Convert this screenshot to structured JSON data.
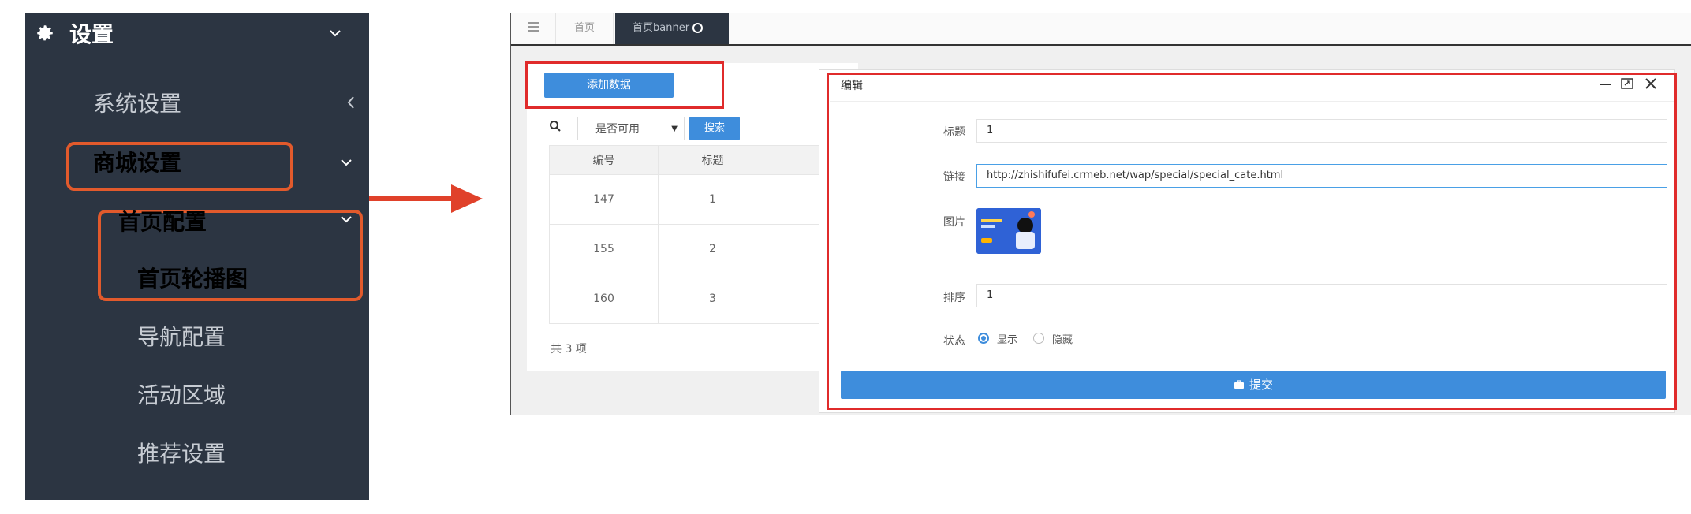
{
  "sidebar": {
    "header": {
      "icon": "gear-icon",
      "title": "设置"
    },
    "items": [
      {
        "label": "系统设置"
      },
      {
        "label": "商城设置"
      },
      {
        "label": "首页配置"
      },
      {
        "label": "首页轮播图"
      },
      {
        "label": "导航配置"
      },
      {
        "label": "活动区域"
      },
      {
        "label": "推荐设置"
      }
    ]
  },
  "tabs": {
    "menu_icon": "hamburger-icon",
    "home": "首页",
    "active": "首页banner"
  },
  "list": {
    "add_button": "添加数据",
    "filter_placeholder": "是否可用",
    "search_button": "搜索",
    "columns": [
      "编号",
      "标题"
    ],
    "rows": [
      {
        "id": "147",
        "title": "1"
      },
      {
        "id": "155",
        "title": "2"
      },
      {
        "id": "160",
        "title": "3"
      }
    ],
    "total": "共 3 项"
  },
  "dialog": {
    "title": "编辑",
    "labels": {
      "title": "标题",
      "link": "链接",
      "image": "图片",
      "sort": "排序",
      "status": "状态"
    },
    "values": {
      "title": "1",
      "link": "http://zhishifufei.crmeb.net/wap/special/special_cate.html",
      "sort": "1"
    },
    "status_options": [
      "显示",
      "隐藏"
    ],
    "status_selected": "显示",
    "submit": "提交"
  },
  "colors": {
    "sidebar_bg": "#2c3542",
    "highlight": "#e25a2c",
    "primary": "#3e8ddc",
    "dialog_border": "#e02b2b"
  }
}
